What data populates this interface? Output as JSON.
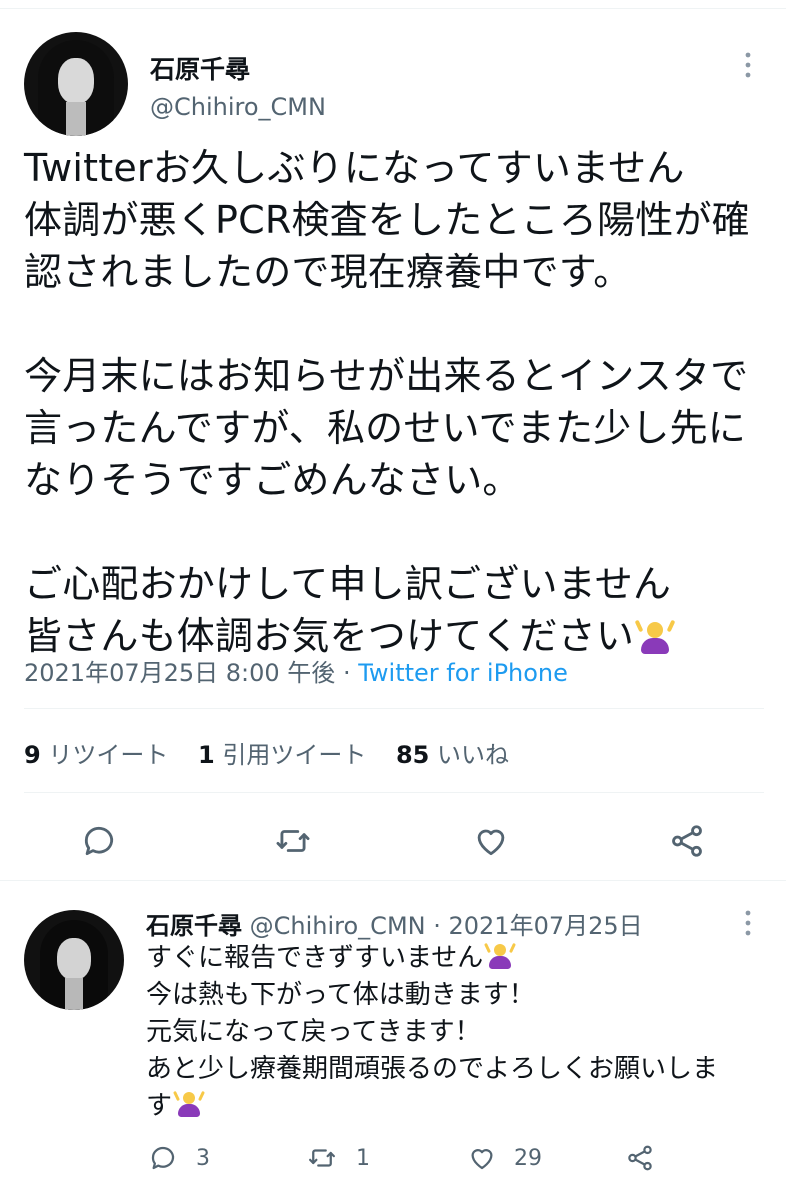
{
  "main_tweet": {
    "display_name": "石原千尋",
    "handle": "@Chihiro_CMN",
    "text_line1": "Twitterお久しぶりになってすいません\n体調が悪くPCR検査をしたところ陽性が確\n認されましたので現在療養中です。\n\n今月末にはお知らせが出来るとインスタで\n言ったんですが、私のせいでまた少し先に\nなりそうですごめんなさい。\n\nご心配おかけして申し訳ございません\n皆さんも体調お気をつけてください",
    "timestamp": "2021年07月25日 8:00 午後",
    "separator": " · ",
    "source": "Twitter for iPhone",
    "retweets_count": "9",
    "retweets_label": "リツイート",
    "quotes_count": "1",
    "quotes_label": "引用ツイート",
    "likes_count": "85",
    "likes_label": "いいね"
  },
  "reply_tweet": {
    "display_name": "石原千尋",
    "handle": "@Chihiro_CMN",
    "dot": " · ",
    "date": "2021年07月25日",
    "line1": "すぐに報告できずすいません",
    "rest": "今は熱も下がって体は動きます！\n元気になって戻ってきます！\nあと少し療養期間頑張るのでよろしくお願いしま\nす",
    "reply_count": "3",
    "retweet_count": "1",
    "like_count": "29"
  },
  "icons": {
    "more": "more-vertical-icon",
    "reply": "reply-bubble-icon",
    "retweet": "retweet-icon",
    "like": "heart-icon",
    "share": "share-icon",
    "emoji": "person-gesturing-ok-emoji"
  },
  "colors": {
    "link": "#1d9bf0",
    "muted": "#536471",
    "text": "#0f1419",
    "icon": "#536471"
  }
}
